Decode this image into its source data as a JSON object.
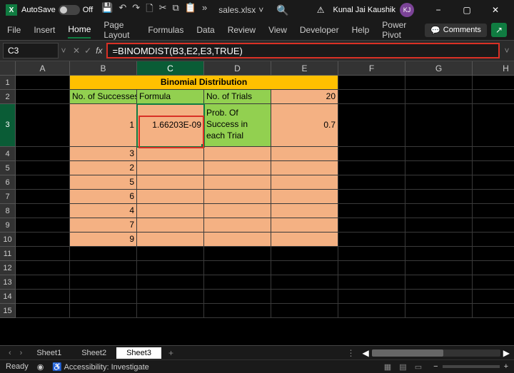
{
  "titlebar": {
    "autosave_label": "AutoSave",
    "autosave_state": "Off",
    "filename": "sales.xlsx",
    "user_name": "Kunal Jai Kaushik",
    "user_initials": "KJ"
  },
  "ribbon": {
    "tabs": [
      "File",
      "Insert",
      "Home",
      "Page Layout",
      "Formulas",
      "Data",
      "Review",
      "View",
      "Developer",
      "Help",
      "Power Pivot"
    ],
    "active_tab": "Home",
    "comments_label": "Comments"
  },
  "formula_bar": {
    "name_box": "C3",
    "formula": "=BINOMDIST(B3,E2,E3,TRUE)"
  },
  "columns": [
    "A",
    "B",
    "C",
    "D",
    "E",
    "F",
    "G",
    "H"
  ],
  "rows": [
    "1",
    "2",
    "3",
    "4",
    "5",
    "6",
    "7",
    "8",
    "9",
    "10",
    "11",
    "12",
    "13",
    "14",
    "15"
  ],
  "sheet": {
    "title": "Binomial Distribution",
    "header_b": "No. of Successes(k)",
    "header_c": "Formula",
    "header_d": "No. of Trials",
    "val_e2": "20",
    "label_d3": "Prob. Of Success in each Trial",
    "val_e3": "0.7",
    "b3": "1",
    "c3": "1.66203E-09",
    "b4": "3",
    "b5": "2",
    "b6": "5",
    "b7": "6",
    "b8": "4",
    "b9": "7",
    "b10": "9"
  },
  "sheet_tabs": {
    "tabs": [
      "Sheet1",
      "Sheet2",
      "Sheet3"
    ],
    "active": "Sheet3"
  },
  "statusbar": {
    "ready": "Ready",
    "accessibility": "Accessibility: Investigate"
  },
  "chart_data": {
    "type": "table",
    "title": "Binomial Distribution",
    "columns": [
      "No. of Successes(k)",
      "Formula",
      "No. of Trials",
      ""
    ],
    "params": {
      "trials": 20,
      "prob_success": 0.7
    },
    "rows": [
      {
        "k": 1,
        "result": 1.66203e-09
      },
      {
        "k": 3
      },
      {
        "k": 2
      },
      {
        "k": 5
      },
      {
        "k": 6
      },
      {
        "k": 4
      },
      {
        "k": 7
      },
      {
        "k": 9
      }
    ]
  }
}
